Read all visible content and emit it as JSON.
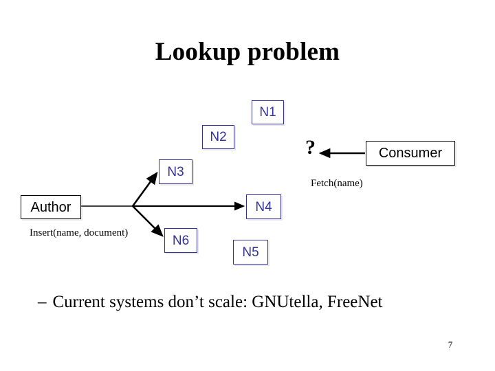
{
  "slide": {
    "title": "Lookup problem",
    "page_number": "7",
    "background_color": "#ffffff"
  },
  "colors": {
    "node_navy": "#33339a",
    "actor_black": "#000000",
    "text_black": "#000000"
  },
  "diagram": {
    "nodes": [
      {
        "id": "n1",
        "label": "N1"
      },
      {
        "id": "n2",
        "label": "N2"
      },
      {
        "id": "n3",
        "label": "N3"
      },
      {
        "id": "n4",
        "label": "N4"
      },
      {
        "id": "n5",
        "label": "N5"
      },
      {
        "id": "n6",
        "label": "N6"
      }
    ],
    "actors": [
      {
        "id": "author",
        "label": "Author"
      },
      {
        "id": "consumer",
        "label": "Consumer"
      }
    ],
    "question_mark": "?",
    "captions": [
      {
        "id": "fetch",
        "text": "Fetch(name)"
      },
      {
        "id": "insert",
        "text": "Insert(name, document)"
      }
    ],
    "edges": [
      {
        "from": "author",
        "to": "n3",
        "style": "arrow"
      },
      {
        "from": "author",
        "to": "n4",
        "style": "arrow"
      },
      {
        "from": "author",
        "to": "n6",
        "style": "arrow"
      },
      {
        "from": "consumer",
        "to": "question_mark",
        "style": "arrow"
      }
    ]
  },
  "bullet": {
    "dash": "–",
    "text": "Current systems don’t scale: GNUtella, FreeNet"
  }
}
